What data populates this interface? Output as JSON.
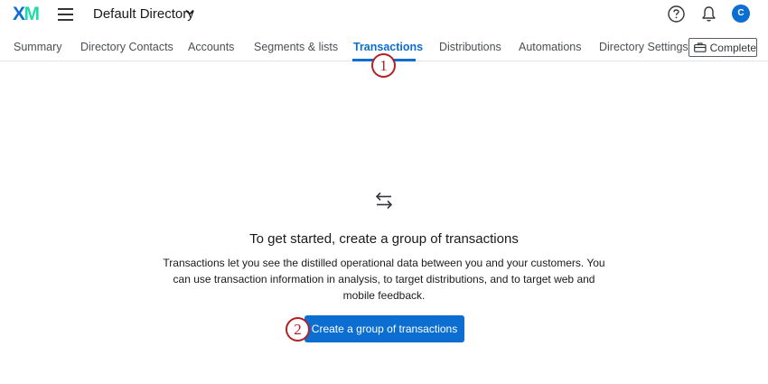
{
  "header": {
    "logo_text_x": "X",
    "logo_text_m": "M",
    "directory_title": "Default Directory",
    "avatar_initial": "C",
    "icons": [
      "hamburger-menu-icon",
      "chevron-down-icon",
      "help-icon",
      "bell-icon"
    ]
  },
  "tabs": [
    {
      "label": "Summary",
      "active": false
    },
    {
      "label": "Directory Contacts",
      "active": false
    },
    {
      "label": "Accounts",
      "active": false
    },
    {
      "label": "Segments & lists",
      "active": false
    },
    {
      "label": "Transactions",
      "active": true
    },
    {
      "label": "Distributions",
      "active": false
    },
    {
      "label": "Automations",
      "active": false
    },
    {
      "label": "Directory Settings",
      "active": false
    }
  ],
  "complete_button": {
    "label": "Complete",
    "icon": "briefcase-icon"
  },
  "markers": {
    "one": "1",
    "two": "2"
  },
  "empty_state": {
    "icon": "swap-arrows-icon",
    "title": "To get started, create a group of transactions",
    "description": "Transactions let you see the distilled operational data between you and your customers. You can use transaction information in analysis, to target distributions, and to target web and mobile feedback.",
    "button_label": "Create a group of transactions"
  },
  "colors": {
    "accent": "#0b6ed0",
    "logo_m": "#21dbaa",
    "marker": "#b51f24",
    "text": "#32363a"
  }
}
